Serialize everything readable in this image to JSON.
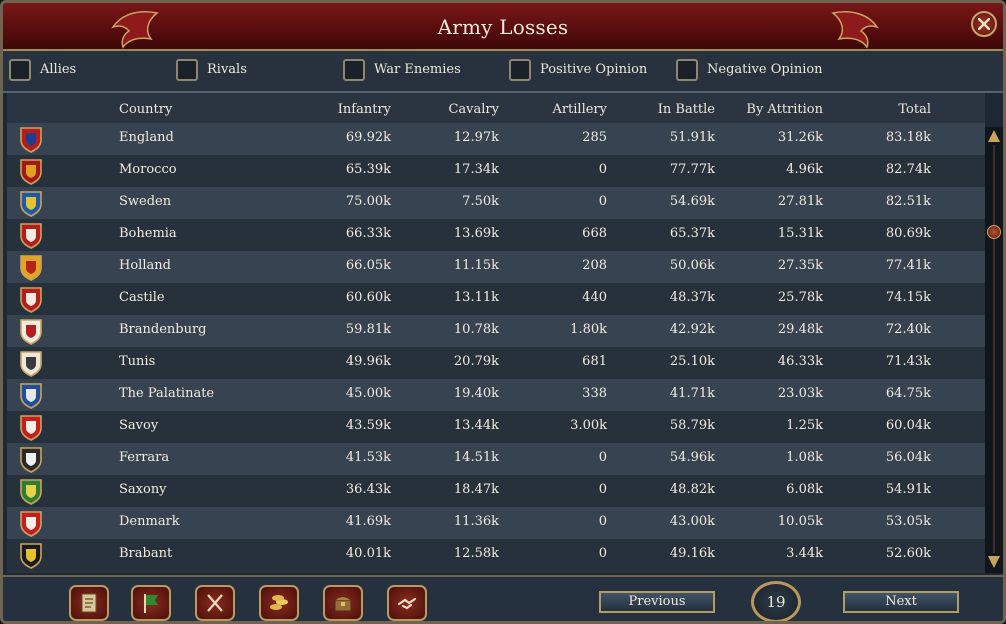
{
  "window": {
    "title": "Army Losses",
    "close_icon": "close-icon"
  },
  "filters": [
    {
      "label": "Allies",
      "checked": false
    },
    {
      "label": "Rivals",
      "checked": false
    },
    {
      "label": "War Enemies",
      "checked": false
    },
    {
      "label": "Positive Opinion",
      "checked": false
    },
    {
      "label": "Negative Opinion",
      "checked": false
    }
  ],
  "table": {
    "columns": [
      "Country",
      "Infantry",
      "Cavalry",
      "Artillery",
      "In Battle",
      "By Attrition",
      "Total"
    ],
    "rows": [
      {
        "country": "England",
        "infantry": "69.92k",
        "cavalry": "12.97k",
        "artillery": "285",
        "in_battle": "51.91k",
        "by_attrition": "31.26k",
        "total": "83.18k",
        "icon": "england-flag-icon"
      },
      {
        "country": "Morocco",
        "infantry": "65.39k",
        "cavalry": "17.34k",
        "artillery": "0",
        "in_battle": "77.77k",
        "by_attrition": "4.96k",
        "total": "82.74k",
        "icon": "morocco-flag-icon"
      },
      {
        "country": "Sweden",
        "infantry": "75.00k",
        "cavalry": "7.50k",
        "artillery": "0",
        "in_battle": "54.69k",
        "by_attrition": "27.81k",
        "total": "82.51k",
        "icon": "sweden-flag-icon"
      },
      {
        "country": "Bohemia",
        "infantry": "66.33k",
        "cavalry": "13.69k",
        "artillery": "668",
        "in_battle": "65.37k",
        "by_attrition": "15.31k",
        "total": "80.69k",
        "icon": "bohemia-flag-icon"
      },
      {
        "country": "Holland",
        "infantry": "66.05k",
        "cavalry": "11.15k",
        "artillery": "208",
        "in_battle": "50.06k",
        "by_attrition": "27.35k",
        "total": "77.41k",
        "icon": "holland-flag-icon"
      },
      {
        "country": "Castile",
        "infantry": "60.60k",
        "cavalry": "13.11k",
        "artillery": "440",
        "in_battle": "48.37k",
        "by_attrition": "25.78k",
        "total": "74.15k",
        "icon": "castile-flag-icon"
      },
      {
        "country": "Brandenburg",
        "infantry": "59.81k",
        "cavalry": "10.78k",
        "artillery": "1.80k",
        "in_battle": "42.92k",
        "by_attrition": "29.48k",
        "total": "72.40k",
        "icon": "brandenburg-flag-icon"
      },
      {
        "country": "Tunis",
        "infantry": "49.96k",
        "cavalry": "20.79k",
        "artillery": "681",
        "in_battle": "25.10k",
        "by_attrition": "46.33k",
        "total": "71.43k",
        "icon": "tunis-flag-icon"
      },
      {
        "country": "The Palatinate",
        "infantry": "45.00k",
        "cavalry": "19.40k",
        "artillery": "338",
        "in_battle": "41.71k",
        "by_attrition": "23.03k",
        "total": "64.75k",
        "icon": "palatinate-flag-icon"
      },
      {
        "country": "Savoy",
        "infantry": "43.59k",
        "cavalry": "13.44k",
        "artillery": "3.00k",
        "in_battle": "58.79k",
        "by_attrition": "1.25k",
        "total": "60.04k",
        "icon": "savoy-flag-icon"
      },
      {
        "country": "Ferrara",
        "infantry": "41.53k",
        "cavalry": "14.51k",
        "artillery": "0",
        "in_battle": "54.96k",
        "by_attrition": "1.08k",
        "total": "56.04k",
        "icon": "ferrara-flag-icon"
      },
      {
        "country": "Saxony",
        "infantry": "36.43k",
        "cavalry": "18.47k",
        "artillery": "0",
        "in_battle": "48.82k",
        "by_attrition": "6.08k",
        "total": "54.91k",
        "icon": "saxony-flag-icon"
      },
      {
        "country": "Denmark",
        "infantry": "41.69k",
        "cavalry": "11.36k",
        "artillery": "0",
        "in_battle": "43.00k",
        "by_attrition": "10.05k",
        "total": "53.05k",
        "icon": "denmark-flag-icon"
      },
      {
        "country": "Brabant",
        "infantry": "40.01k",
        "cavalry": "12.58k",
        "artillery": "0",
        "in_battle": "49.16k",
        "by_attrition": "3.44k",
        "total": "52.60k",
        "icon": "brabant-flag-icon"
      }
    ]
  },
  "toolbar": {
    "buttons": [
      "ledger-icon",
      "flag-icon",
      "crossed-swords-icon",
      "coins-icon",
      "chest-icon",
      "handshake-icon"
    ]
  },
  "pagination": {
    "previous_label": "Previous",
    "next_label": "Next",
    "page": "19"
  },
  "colors": {
    "title_red": "#6a1112",
    "gold_trim": "#b8985a",
    "row_even": "#374350",
    "row_odd": "#27313c"
  }
}
